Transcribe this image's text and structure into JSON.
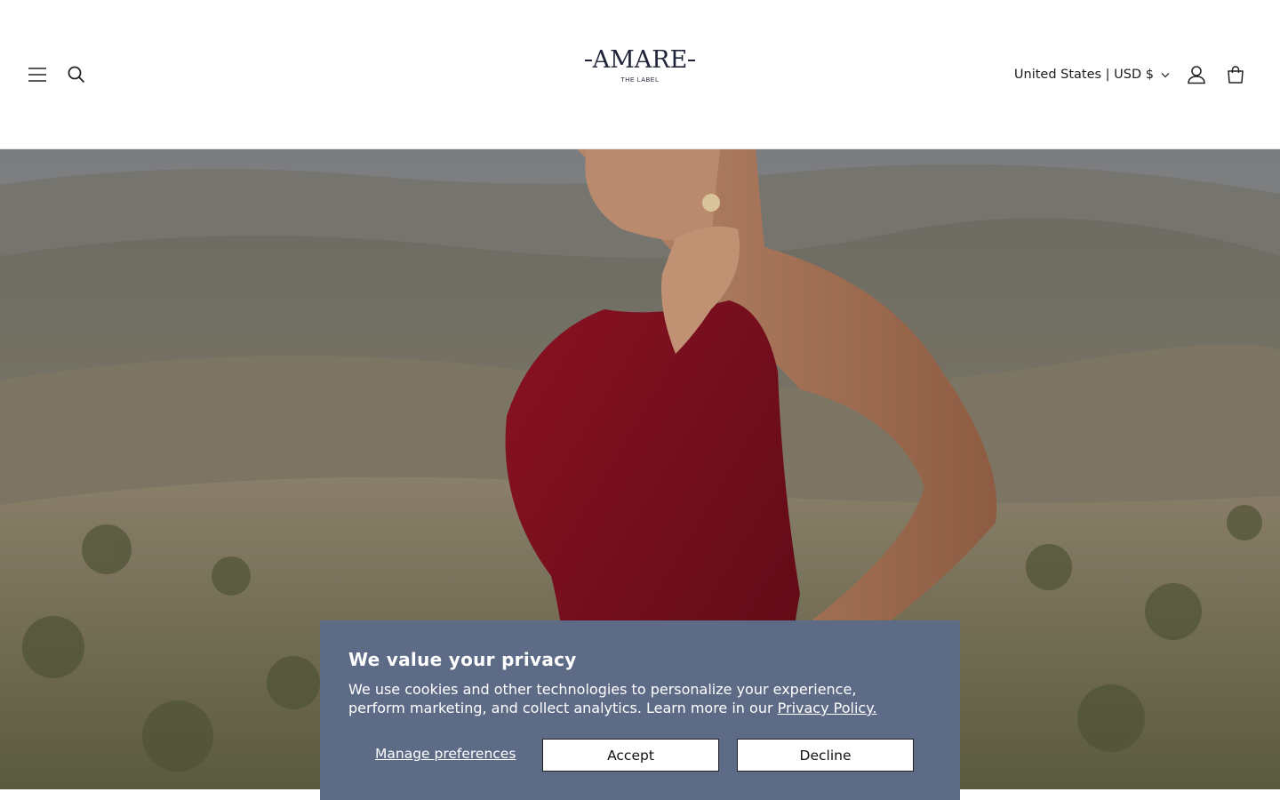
{
  "header": {
    "menu_icon": "hamburger-menu-icon",
    "search_icon": "search-icon",
    "logo": {
      "name": "AMARE",
      "tagline": "THE LABEL"
    },
    "country_selector": {
      "label": "United States | USD $",
      "icon": "chevron-down-icon"
    },
    "account_icon": "user-icon",
    "cart_icon": "bag-icon"
  },
  "hero": {
    "image_alt": "Model in red halter dress against mountain landscape"
  },
  "cookie_banner": {
    "title": "We value your privacy",
    "text": "We use cookies and other technologies to personalize your experience, perform marketing, and collect analytics. Learn more in our ",
    "link_label": "Privacy Policy.",
    "manage_label": "Manage preferences",
    "accept_label": "Accept",
    "decline_label": "Decline",
    "background_color": "#5d6b86"
  }
}
